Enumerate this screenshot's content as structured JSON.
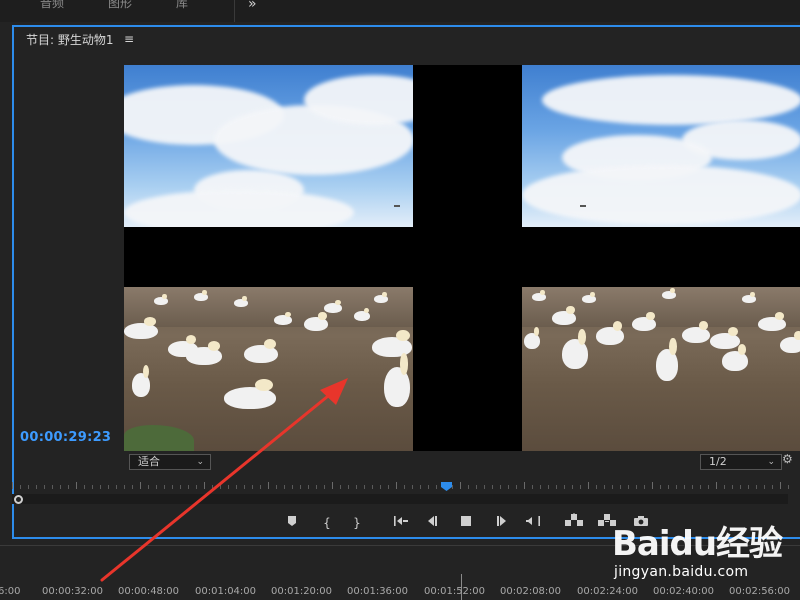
{
  "workspace_tabs": [
    {
      "label": "音频"
    },
    {
      "label": "图形"
    },
    {
      "label": "库"
    }
  ],
  "more_glyph": "»",
  "panel": {
    "title": "节目: 野生动物1",
    "menu_glyph": "≡"
  },
  "monitor": {
    "timecode": "00:00:29:23",
    "zoom_select": "适合",
    "resolution_select": "1/2"
  },
  "icons": {
    "settings": "wrench-icon",
    "transport": [
      "add-marker-icon",
      "mark-in-icon",
      "mark-out-icon",
      "go-to-in-icon",
      "step-back-icon",
      "stop-icon",
      "step-forward-icon",
      "go-to-out-icon",
      "lift-icon",
      "extract-icon",
      "export-frame-icon"
    ]
  },
  "timeline": {
    "ruler_labels": [
      "6:00",
      "00:00:32:00",
      "00:00:48:00",
      "00:01:04:00",
      "00:01:20:00",
      "00:01:36:00",
      "00:01:52:00",
      "00:02:08:00",
      "00:02:24:00",
      "00:02:40:00",
      "00:02:56:00"
    ]
  },
  "watermark": {
    "logo": "Baidu经验",
    "url": "jingyan.baidu.com"
  },
  "colors": {
    "accent": "#2d8ceb",
    "timecode": "#3d9bff",
    "annotation": "#e8352b"
  }
}
